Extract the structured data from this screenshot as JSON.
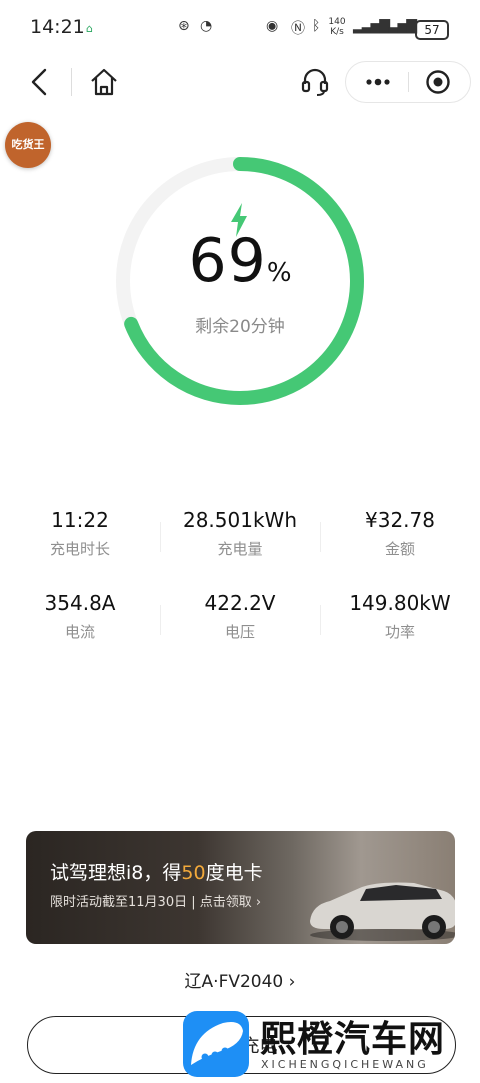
{
  "status_bar": {
    "time": "14:21",
    "net_speed": "140 K/s",
    "battery": "57"
  },
  "nav": {
    "avatar_text": "吃货王"
  },
  "charge": {
    "percent": "69",
    "percent_unit": "%",
    "percent_fraction": 0.69,
    "remaining": "剩余20分钟",
    "accent": "#45c875"
  },
  "stats": [
    {
      "value": "11:22",
      "label": "充电时长"
    },
    {
      "value": "28.501kWh",
      "label": "充电量"
    },
    {
      "value": "¥32.78",
      "label": "金额"
    },
    {
      "value": "354.8A",
      "label": "电流"
    },
    {
      "value": "422.2V",
      "label": "电压"
    },
    {
      "value": "149.80kW",
      "label": "功率"
    }
  ],
  "banner": {
    "title_pre": "试驾理想i8，得",
    "title_highlight": "50",
    "title_post": "度电卡",
    "subtitle": "限时活动截至11月30日 | 点击领取 ›"
  },
  "vehicle": {
    "plate": "辽A·FV2040 ›"
  },
  "bottom": {
    "button_text": "结束充电"
  },
  "watermark": {
    "name": "熙橙汽车网",
    "sub": "XICHENGQICHEWANG"
  }
}
